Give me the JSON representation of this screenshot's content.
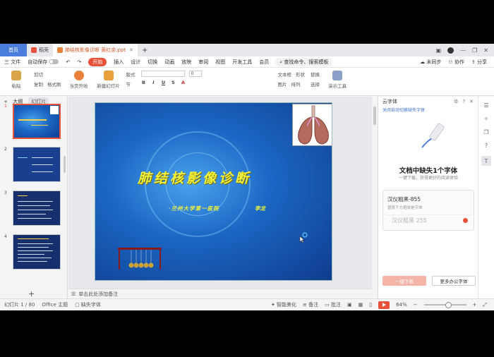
{
  "titlebar": {
    "home_tab": "首页",
    "tab_wps": "稻壳",
    "doc_tab": "肺结核影像诊断 黄红余.ppt"
  },
  "menubar": {
    "file": "三 文件",
    "autosave": "自动保存",
    "items": [
      "开始",
      "插入",
      "设计",
      "切换",
      "动画",
      "放映",
      "审阅",
      "视图",
      "开发工具",
      "会员"
    ],
    "active": "开始",
    "search": "查找命令、搜索模板",
    "not_synced": "未同步",
    "collab": "协作",
    "share": "分享"
  },
  "ribbon": {
    "format_painter": "格式刷",
    "paste": "粘贴",
    "cut": "剪切",
    "copy": "复制",
    "from_start": "当页开始",
    "new_slide": "新建幻灯片",
    "layout": "版式",
    "section": "节",
    "font_size": "0",
    "text_box": "文本框",
    "shape": "形状",
    "arrange": "排列",
    "picture": "图片",
    "replace": "替换",
    "select": "选择",
    "presenter": "演示工具"
  },
  "leftpanel": {
    "tab_outline": "大纲",
    "tab_slides": "幻灯片",
    "thumb_numbers": [
      "1",
      "2",
      "3",
      "4"
    ]
  },
  "slide": {
    "title": "肺结核影像诊断",
    "subtitle": "·兰州大学第一医院",
    "author": "李龙"
  },
  "notes_placeholder": "单击此处添加备注",
  "rightpanel": {
    "header": "云字体",
    "link": "关闭自动切换缺失字体",
    "title": "文档中缺失1个字体",
    "desc": "一键下载，获得更好的阅读体验",
    "font_name": "汉仪粗黑-855",
    "font_note": "替换下方粗体是字体",
    "font_preview": "汉仪粗黑 255",
    "download_btn": "一键下载",
    "more_btn": "更多办公字体"
  },
  "statusbar": {
    "slide_info": "幻灯片 1 / 80",
    "theme": "Office 主题",
    "missing_font": "缺失字体",
    "smart_beautify": "智能美化",
    "notes": "备注",
    "comments": "批注",
    "zoom": "64%"
  },
  "colors": {
    "accent": "#e8523a",
    "home_tab": "#4a7ddc",
    "slide_bg": "#1b67c4",
    "slide_title": "#f2f23a"
  }
}
